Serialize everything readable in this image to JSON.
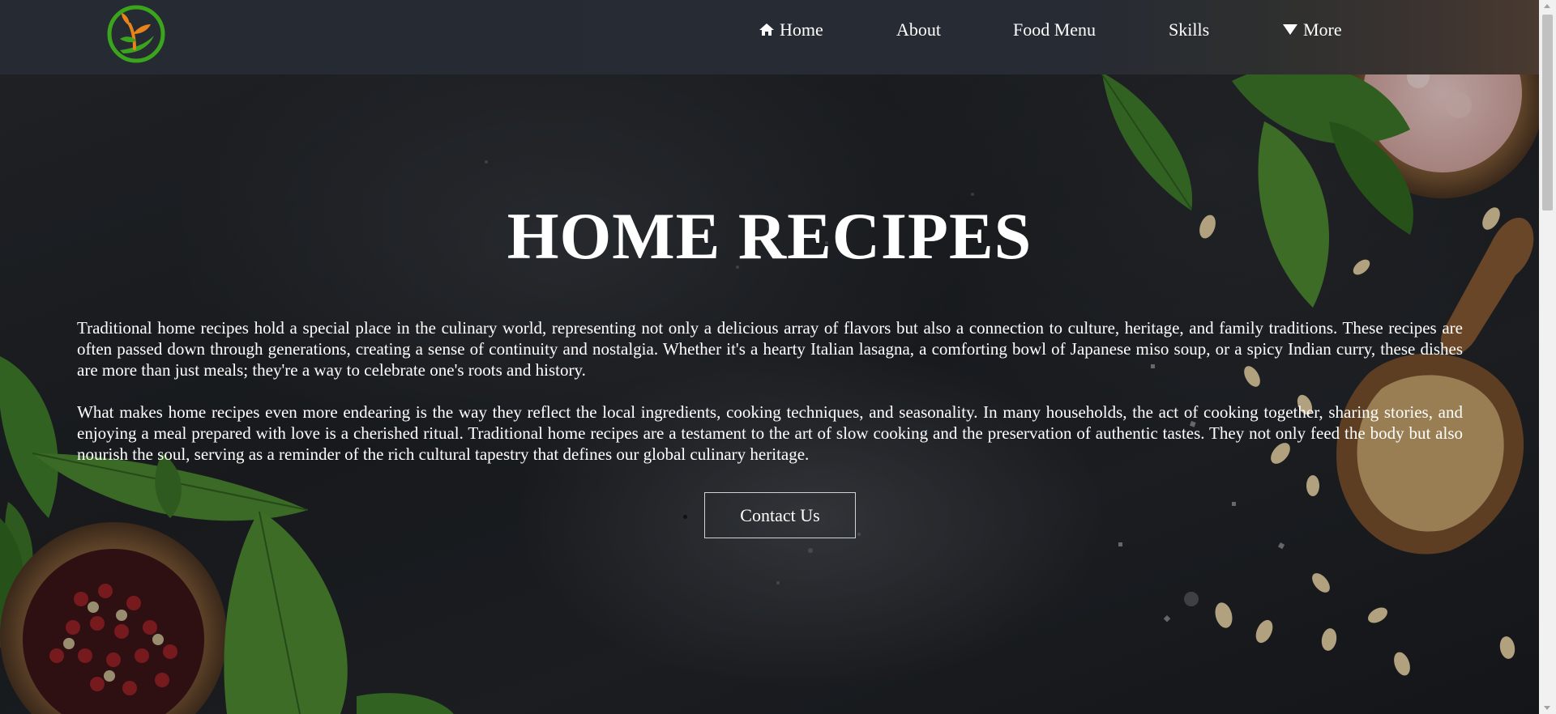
{
  "header": {
    "logo_icon": "sprout-leaf-logo-icon",
    "nav": [
      {
        "label": "Home",
        "icon": "home-icon"
      },
      {
        "label": "About"
      },
      {
        "label": "Food Menu"
      },
      {
        "label": "Skills"
      },
      {
        "label": "More",
        "icon": "caret-down-icon"
      }
    ]
  },
  "hero": {
    "title": "HOME RECIPES",
    "paragraphs": [
      "Traditional home recipes hold a special place in the culinary world, representing not only a delicious array of flavors but also a connection to culture, heritage, and family traditions. These recipes are often passed down through generations, creating a sense of continuity and nostalgia. Whether it's a hearty Italian lasagna, a comforting bowl of Japanese miso soup, or a spicy Indian curry, these dishes are more than just meals; they're a way to celebrate one's roots and history.",
      "What makes home recipes even more endearing is the way they reflect the local ingredients, cooking techniques, and seasonality. In many households, the act of cooking together, sharing stories, and enjoying a meal prepared with love is a cherished ritual. Traditional home recipes are a testament to the art of slow cooking and the preservation of authentic tastes. They not only feed the body but also nourish the soul, serving as a reminder of the rich cultural tapestry that defines our global culinary heritage."
    ],
    "cta_label": "Contact Us"
  },
  "colors": {
    "header_bg": "#262a32",
    "logo_green": "#3aa51c",
    "logo_orange": "#e8841a",
    "button_border": "#cfd2d6"
  }
}
